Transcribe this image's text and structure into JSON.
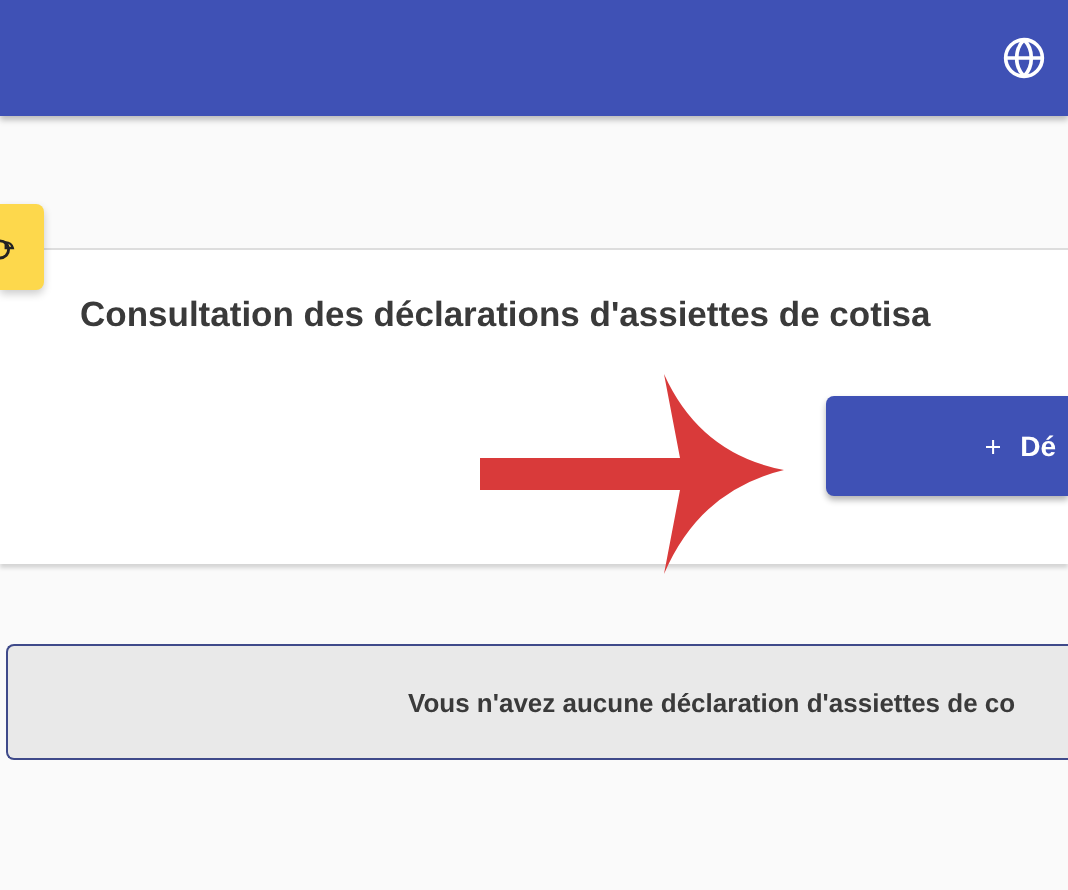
{
  "header": {
    "language_button": {
      "kind": "globe"
    }
  },
  "card": {
    "title": "Consultation des déclarations d'assiettes de cotisa",
    "add_button": {
      "label": "Dé"
    }
  },
  "empty_message": "Vous n'avez aucune déclaration d'assiettes de co"
}
